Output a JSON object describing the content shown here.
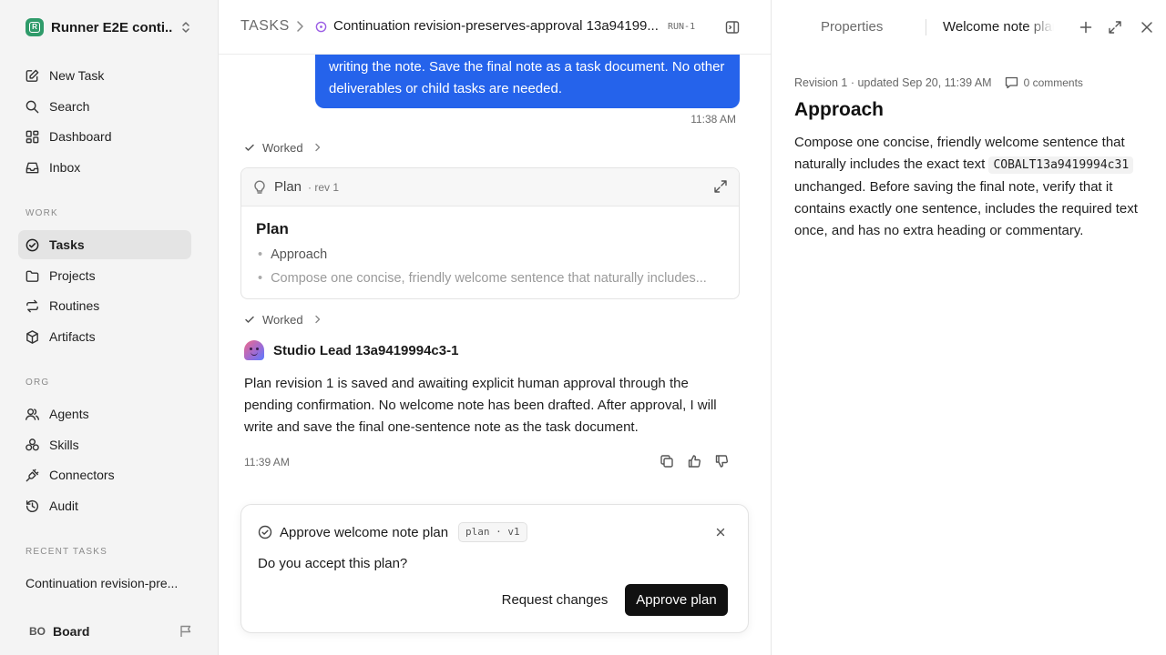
{
  "workspace": {
    "name": "Runner E2E conti...",
    "logo_letter": "R"
  },
  "nav": {
    "new_task": "New Task",
    "search": "Search",
    "dashboard": "Dashboard",
    "inbox": "Inbox"
  },
  "sections": {
    "work": "WORK",
    "org": "ORG",
    "recent": "RECENT TASKS"
  },
  "work_items": {
    "tasks": "Tasks",
    "projects": "Projects",
    "routines": "Routines",
    "artifacts": "Artifacts"
  },
  "org_items": {
    "agents": "Agents",
    "skills": "Skills",
    "connectors": "Connectors",
    "audit": "Audit"
  },
  "recent": {
    "item_1": "Continuation revision-pre..."
  },
  "user": {
    "initials": "BO",
    "name": "Board"
  },
  "header": {
    "root": "TASKS",
    "title": "Continuation revision-preserves-approval 13a94199...",
    "tag": "RUN-1"
  },
  "conversation": {
    "user_message": "writing the note. Save the final note as a task document. No other deliverables or child tasks are needed.",
    "user_time": "11:38 AM",
    "worked_label": "Worked",
    "plan_card": {
      "name": "Plan",
      "rev": "· rev 1",
      "title": "Plan",
      "bullets": [
        "Approach",
        "Compose one concise, friendly welcome sentence that naturally includes..."
      ]
    },
    "agent_name": "Studio Lead 13a9419994c3-1",
    "agent_message": "Plan revision 1 is saved and awaiting explicit human approval through the pending confirmation. No welcome note has been drafted. After approval, I will write and save the final one-sentence note as the task document.",
    "agent_time": "11:39 AM"
  },
  "approval": {
    "title": "Approve welcome note plan",
    "tag": "plan · v1",
    "question": "Do you accept this plan?",
    "request_changes": "Request changes",
    "approve": "Approve plan"
  },
  "panel": {
    "tab_properties": "Properties",
    "tab_document": "Welcome note plan",
    "meta": "Revision 1 · updated Sep 20, 11:39 AM",
    "comments": "0 comments",
    "heading": "Approach",
    "body_before": "Compose one concise, friendly welcome sentence that naturally includes the exact text ",
    "body_code": "COBALT13a9419994c31",
    "body_after": " unchanged. Before saving the final note, verify that it contains exactly one sentence, includes the required text once, and has no extra heading or commentary."
  }
}
